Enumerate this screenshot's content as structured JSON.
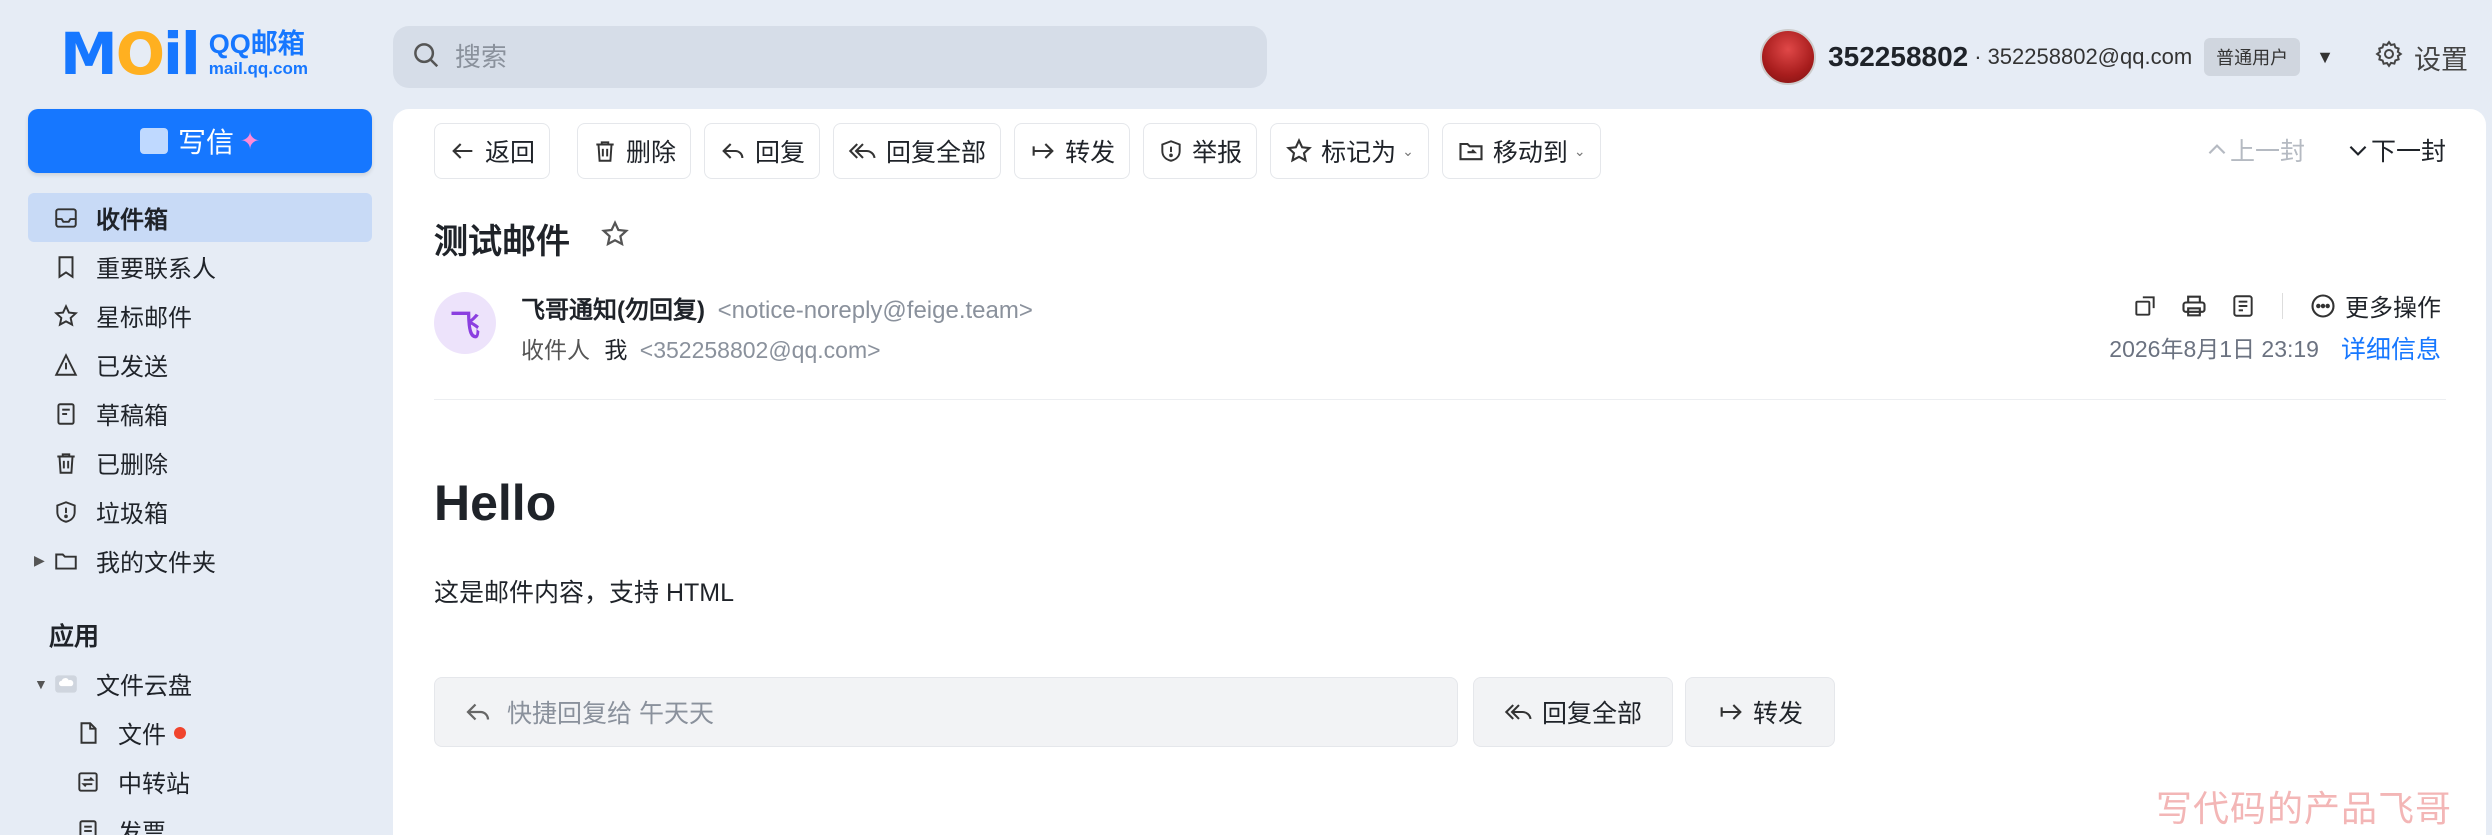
{
  "brand": {
    "logo_text": "MOil",
    "name_cn": "QQ邮箱",
    "domain": "mail.qq.com"
  },
  "search": {
    "placeholder": "搜索"
  },
  "user": {
    "id": "352258802",
    "separator": "·",
    "email": "352258802@qq.com",
    "level_badge": "普通用户",
    "settings_label": "设置"
  },
  "sidebar": {
    "compose_label": "写信",
    "items": [
      {
        "label": "收件箱",
        "icon": "inbox-icon",
        "active": true
      },
      {
        "label": "重要联系人",
        "icon": "bookmark-icon"
      },
      {
        "label": "星标邮件",
        "icon": "star-icon"
      },
      {
        "label": "已发送",
        "icon": "sent-icon"
      },
      {
        "label": "草稿箱",
        "icon": "draft-icon"
      },
      {
        "label": "已删除",
        "icon": "trash-icon"
      },
      {
        "label": "垃圾箱",
        "icon": "spam-shield-icon"
      },
      {
        "label": "我的文件夹",
        "icon": "folder-icon"
      }
    ],
    "apps_title": "应用",
    "apps": [
      {
        "label": "文件云盘",
        "icon": "cloud-drive-icon"
      },
      {
        "label": "文件",
        "icon": "file-icon",
        "has_dot": true
      },
      {
        "label": "中转站",
        "icon": "transfer-icon"
      },
      {
        "label": "发票",
        "icon": "invoice-icon"
      }
    ]
  },
  "toolbar": {
    "back": "返回",
    "delete": "删除",
    "reply": "回复",
    "reply_all": "回复全部",
    "forward": "转发",
    "report": "举报",
    "mark_as": "标记为",
    "move_to": "移动到",
    "prev": "上一封",
    "next": "下一封"
  },
  "mail": {
    "subject": "测试邮件",
    "sender_avatar_char": "飞",
    "sender_name": "飞哥通知(勿回复)",
    "sender_addr": "<notice-noreply@feige.team>",
    "recipient_label": "收件人",
    "recipient_name": "我",
    "recipient_addr": "<352258802@qq.com>",
    "more_actions": "更多操作",
    "datetime": "2026年8月1日 23:19",
    "detail_link": "详细信息",
    "body_heading": "Hello",
    "body_text": "这是邮件内容，支持 HTML"
  },
  "quick_reply": {
    "placeholder": "快捷回复给 午天天",
    "reply_all": "回复全部",
    "forward": "转发"
  },
  "watermark": "写代码的产品飞哥",
  "colors": {
    "accent": "#1677ff",
    "page_bg": "#e6ecf5",
    "active_item": "#c8daf6",
    "watermark": "#f3b6b6"
  }
}
